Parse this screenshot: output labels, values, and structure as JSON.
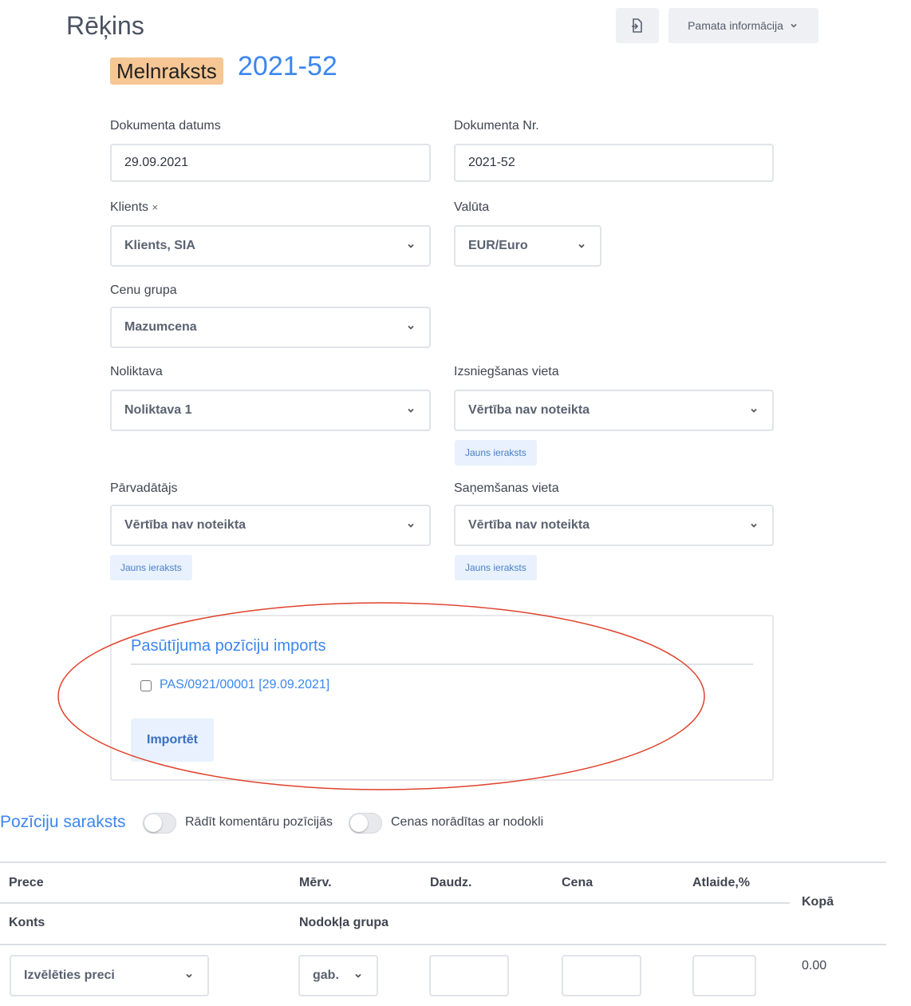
{
  "header": {
    "title": "Rēķins",
    "info_button": "Pamata informācija",
    "export_icon": "file-export-icon"
  },
  "status": {
    "badge": "Melnraksts",
    "document_number": "2021-52",
    "badge_color": "#f6c794",
    "accent_color": "#3b86f0"
  },
  "form": {
    "doc_date_label": "Dokumenta datums",
    "doc_date_value": "29.09.2021",
    "doc_no_label": "Dokumenta Nr.",
    "doc_no_value": "2021-52",
    "client_label": "Klients",
    "client_required": "×",
    "client_value": "Klients, SIA",
    "currency_label": "Valūta",
    "currency_value": "EUR/Euro",
    "price_group_label": "Cenu grupa",
    "price_group_value": "Mazumcena",
    "warehouse_label": "Noliktava",
    "warehouse_value": "Noliktava 1",
    "issue_place_label": "Izsniegšanas vieta",
    "issue_place_value": "Vērtība nav noteikta",
    "carrier_label": "Pārvadātājs",
    "carrier_value": "Vērtība nav noteikta",
    "receive_place_label": "Saņemšanas vieta",
    "receive_place_value": "Vērtība nav noteikta",
    "new_entry": "Jauns ieraksts"
  },
  "import": {
    "title": "Pasūtījuma pozīciju imports",
    "order_item": "PAS/0921/00001 [29.09.2021]",
    "button": "Importēt"
  },
  "positions": {
    "title": "Pozīciju saraksts",
    "toggle_comments": "Rādīt komentāru pozīcijās",
    "toggle_tax": "Cenas norādītas ar nodokli",
    "columns": {
      "product": "Prece",
      "unit": "Mērv.",
      "qty": "Daudz.",
      "price": "Cena",
      "discount": "Atlaide,%",
      "total": "Kopā",
      "account": "Konts",
      "tax_group": "Nodokļa grupa"
    },
    "row": {
      "product_placeholder": "Izvēlēties preci",
      "unit_value": "gab.",
      "total_value": "0.00"
    }
  }
}
